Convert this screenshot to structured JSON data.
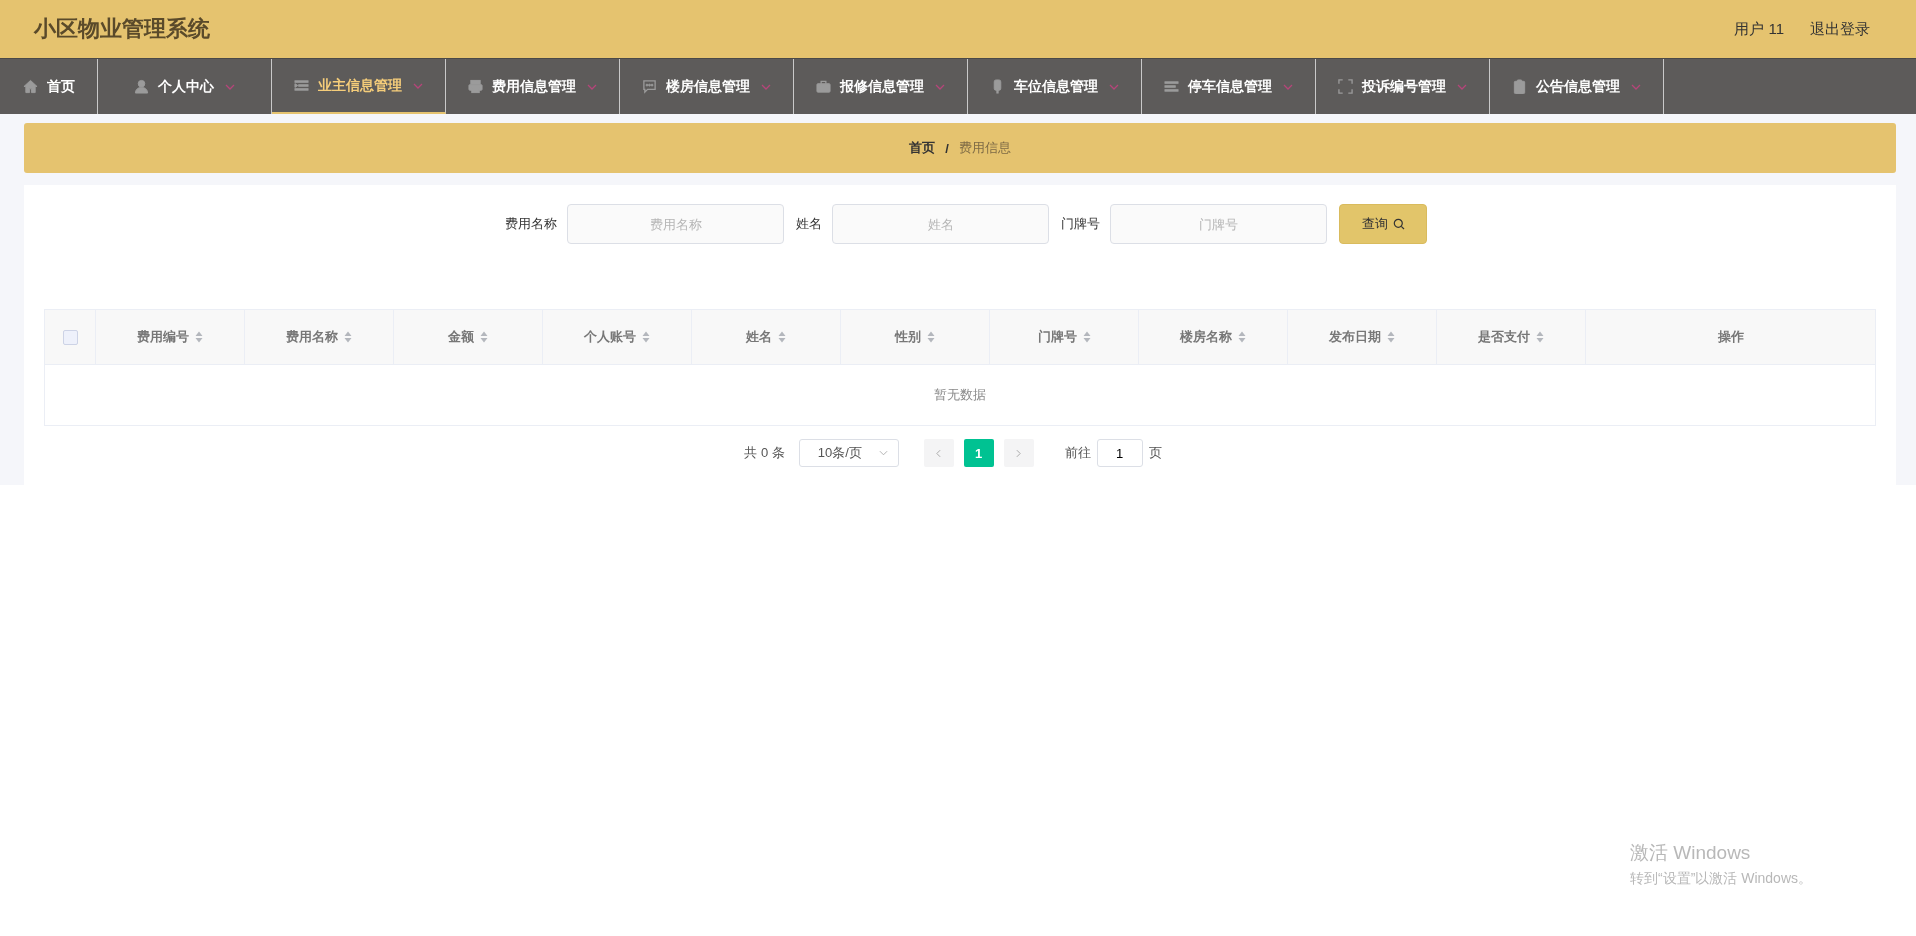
{
  "header": {
    "title": "小区物业管理系统",
    "user": "用户 11",
    "logout": "退出登录"
  },
  "nav": [
    {
      "kind": "link",
      "label": "首页",
      "selected": false
    },
    {
      "kind": "submenu",
      "label": "个人中心",
      "selected": false
    },
    {
      "kind": "submenu",
      "label": "业主信息管理",
      "selected": true
    },
    {
      "kind": "submenu",
      "label": "费用信息管理",
      "selected": false
    },
    {
      "kind": "submenu",
      "label": "楼房信息管理",
      "selected": false
    },
    {
      "kind": "submenu",
      "label": "报修信息管理",
      "selected": false
    },
    {
      "kind": "submenu",
      "label": "车位信息管理",
      "selected": false
    },
    {
      "kind": "submenu",
      "label": "停车信息管理",
      "selected": false
    },
    {
      "kind": "submenu",
      "label": "投诉编号管理",
      "selected": false
    },
    {
      "kind": "submenu",
      "label": "公告信息管理",
      "selected": false
    }
  ],
  "breadcrumb": [
    {
      "label": "首页",
      "selected": false
    },
    {
      "label": "费用信息",
      "selected": true
    }
  ],
  "breadcrumb_separator": "/",
  "search": {
    "fields": [
      {
        "label": "费用名称",
        "placeholder": "费用名称"
      },
      {
        "label": "姓名",
        "placeholder": "姓名"
      },
      {
        "label": "门牌号",
        "placeholder": "门牌号"
      }
    ],
    "button": "查询"
  },
  "table": {
    "select_all_checked": false,
    "columns": [
      {
        "kind": "sortable",
        "label": "费用编号"
      },
      {
        "kind": "sortable",
        "label": "费用名称"
      },
      {
        "kind": "sortable",
        "label": "金额"
      },
      {
        "kind": "sortable",
        "label": "个人账号"
      },
      {
        "kind": "sortable",
        "label": "姓名"
      },
      {
        "kind": "sortable",
        "label": "性别"
      },
      {
        "kind": "sortable",
        "label": "门牌号"
      },
      {
        "kind": "sortable",
        "label": "楼房名称"
      },
      {
        "kind": "sortable",
        "label": "发布日期"
      },
      {
        "kind": "sortable",
        "label": "是否支付"
      },
      {
        "kind": "actions",
        "label": "操作"
      }
    ],
    "empty_text": "暂无数据"
  },
  "pagination": {
    "total": "共 0 条",
    "page_size": "10条/页",
    "pages": [
      {
        "label": "1",
        "selected": true
      }
    ],
    "goto_label": "前往",
    "goto_value": "1",
    "goto_suffix": "页"
  },
  "os_notice": {
    "title": "激活 Windows",
    "text": "转到“设置”以激活 Windows。"
  }
}
